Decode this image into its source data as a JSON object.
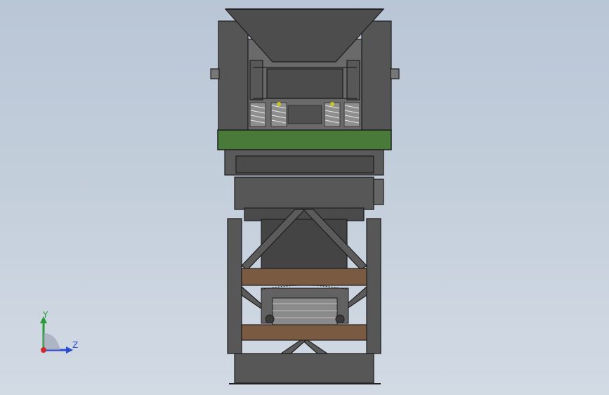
{
  "viewport": {
    "background_top": "#b9c6d6",
    "background_bottom": "#d2dae4"
  },
  "model": {
    "steel_color": "#4f4f4f",
    "steel_dark": "#3a3a3a",
    "steel_light": "#6b6b6b",
    "band_color": "#4a7a3a",
    "timber_color": "#7a5a40",
    "spring_color": "#b0b0b0"
  },
  "triad": {
    "y_label": "Y",
    "z_label": "Z",
    "y_color": "#2a9a3a",
    "z_color": "#2a4ad0",
    "x_color": "#d02a2a"
  }
}
